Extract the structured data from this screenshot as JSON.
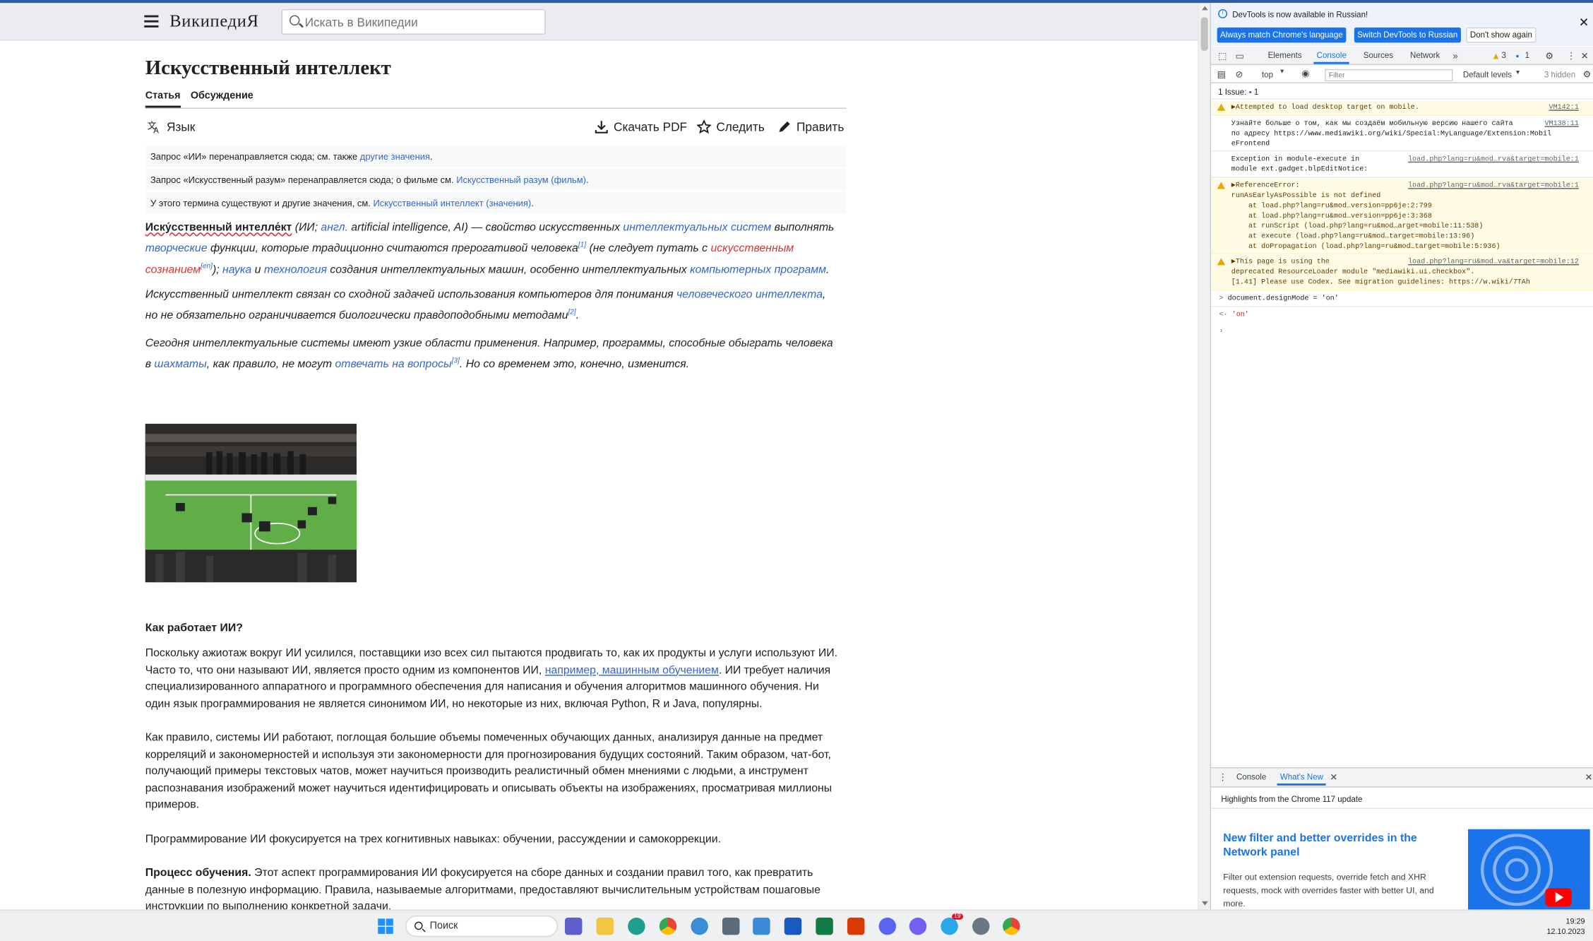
{
  "wiki": {
    "logo": "ВикипедиЯ",
    "search_placeholder": "Искать в Википедии",
    "title": "Искусственный интеллект",
    "tabs": [
      "Статья",
      "Обсуждение"
    ],
    "toolbar": {
      "language": "Язык",
      "pdf": "Скачать PDF",
      "watch": "Следить",
      "edit": "Править"
    },
    "hatnotes": [
      {
        "text": "Запрос «ИИ» перенаправляется сюда; см. также ",
        "link": "другие значения",
        "end": "."
      },
      {
        "text": "Запрос «Искусственный разум» перенаправляется сюда; о фильме см. ",
        "link": "Искусственный разум (фильм)",
        "end": "."
      },
      {
        "text": "У этого термина существуют и другие значения, см. ",
        "link": "Искусственный интеллект (значения)",
        "end": "."
      }
    ],
    "lead": {
      "term": "Иску́сственный интелле́кт",
      "p1a": " (ИИ; ",
      "p1_lang": "англ.",
      "p1b": " artificial intelligence, AI) — свойство искусственных ",
      "p1_link1": "интеллектуальных систем",
      "p1c": " выполнять ",
      "p1_link2": "творческие",
      "p1d": " функции, которые традиционно считаются прерогативой человека",
      "ref1": "[1]",
      "p1e": " (не следует путать с ",
      "p1_red": "искусственным сознанием",
      "ref_en": "[en]",
      "p1f": "); ",
      "p1_link3": "наука",
      "p1g": " и ",
      "p1_link4": "технология",
      "p1h": " создания интеллектуальных машин, особенно интеллектуальных ",
      "p1_link5": "компьютерных программ",
      "p1i": ".",
      "p2a": "Искусственный интеллект связан со сходной задачей использования компьютеров для понимания ",
      "p2_link": "человеческого интеллекта",
      "p2b": ", но не обязательно ограничивается биологически правдоподобными методами",
      "ref2": "[2]",
      "p2c": ".",
      "p3a": "Сегодня интеллектуальные системы имеют узкие области применения. Например, программы, способные обыграть человека в ",
      "p3_link1": "шахматы",
      "p3b": ", как правило, не могут ",
      "p3_link2": "отвечать на вопросы",
      "ref3": "[3]",
      "p3c": ". Но со временем это, конечно, изменится."
    },
    "section_heading": "Как работает ИИ?",
    "body": {
      "b1a": "Поскольку ажиотаж вокруг ИИ усилился, поставщики изо всех сил пытаются продвигать то, как их продукты и услуги используют ИИ. Часто то, что они называют ИИ, является просто одним из компонентов ИИ, ",
      "b1_link": "например, машинным обучением",
      "b1b": ". ИИ требует наличия специализированного аппаратного и программного обеспечения для написания и обучения алгоритмов машинного обучения. Ни один язык программирования не является синонимом ИИ, но некоторые из них, включая Python, R и Java, популярны.",
      "b2": "Как правило, системы ИИ работают, поглощая большие объемы помеченных обучающих данных, анализируя данные на предмет корреляций и закономерностей и используя эти закономерности для прогнозирования будущих состояний. Таким образом, чат-бот, получающий примеры текстовых чатов, может научиться производить реалистичный обмен мнениями с людьми, а инструмент распознавания изображений может научиться идентифицировать и описывать объекты на изображениях, просматривая миллионы примеров.",
      "b3": "Программирование ИИ фокусируется на трех когнитивных навыках: обучении, рассуждении и самокоррекции.",
      "b4_bold": "Процесс обучения.",
      "b4": " Этот аспект программирования ИИ фокусируется на сборе данных и создании правил того, как превратить данные в полезную информацию. Правила, называемые алгоритмами, предоставляют вычислительным устройствам пошаговые инструкции по выполнению конкретной задачи."
    }
  },
  "devtools": {
    "info": "DevTools is now available in Russian!",
    "btn_match": "Always match Chrome's language",
    "btn_switch": "Switch DevTools to Russian",
    "btn_dont": "Don't show again",
    "tabs": [
      "Elements",
      "Console",
      "Sources",
      "Network"
    ],
    "warn_count": "3",
    "msg_count": "1",
    "context": "top",
    "filter_placeholder": "Filter",
    "levels": "Default levels",
    "hidden": "3 hidden",
    "issues": "1 Issue:",
    "issues_count": "1",
    "console": [
      {
        "text": "▶Attempted to load desktop target on mobile.",
        "src": "VM142:1"
      },
      {
        "text": "Узнайте больше о том, как мы создаём мобильную версию нашего сайта\nпо адресу https://www.mediawiki.org/wiki/Special:MyLanguage/Extension:Mobil\neFrontend",
        "src": "VM138:11"
      },
      {
        "text": "Exception in module-execute in\nmodule ext.gadget.blpEditNotice:",
        "src": "load.php?lang=ru&mod…rva&target=mobile:1"
      },
      {
        "text": "▶ReferenceError:\nrunAsEarlyAsPossible is not defined\n    at load.php?lang=ru&mod…version=pp6je:2:799\n    at load.php?lang=ru&mod…version=pp6je:3:368\n    at runScript (load.php?lang=ru&mod…arget=mobile:11:538)\n    at execute (load.php?lang=ru&mod…target=mobile:13:96)\n    at doPropagation (load.php?lang=ru&mod…target=mobile:5:936)",
        "src": "load.php?lang=ru&mod…rva&target=mobile:1"
      },
      {
        "text": "▶This page is using the\ndeprecated ResourceLoader module \"mediawiki.ui.checkbox\".\n[1.41] Please use Codex. See migration guidelines: https://w.wiki/7TAh",
        "src": "load.php?lang=ru&mod…va&target=mobile:12"
      }
    ],
    "cmd": "document.designMode = 'on'",
    "result": "'on'",
    "drawer_tabs": [
      "Console",
      "What's New"
    ],
    "drawer_sub": "Highlights from the Chrome 117 update",
    "drawer_head": "New filter and better overrides in the Network panel",
    "drawer_text": "Filter out extension requests, override fetch and XHR requests, mock with overrides faster with better UI, and more."
  },
  "taskbar": {
    "search": "Поиск",
    "time": "19:29",
    "date": "12.10.2023",
    "icons": [
      "windows-start",
      "search",
      "meet",
      "file-explorer",
      "edge",
      "chrome",
      "vpn",
      "calculator",
      "notepad",
      "word",
      "excel",
      "office",
      "discord",
      "viber",
      "telegram",
      "settings",
      "chrome-profile"
    ],
    "badge": "19"
  }
}
